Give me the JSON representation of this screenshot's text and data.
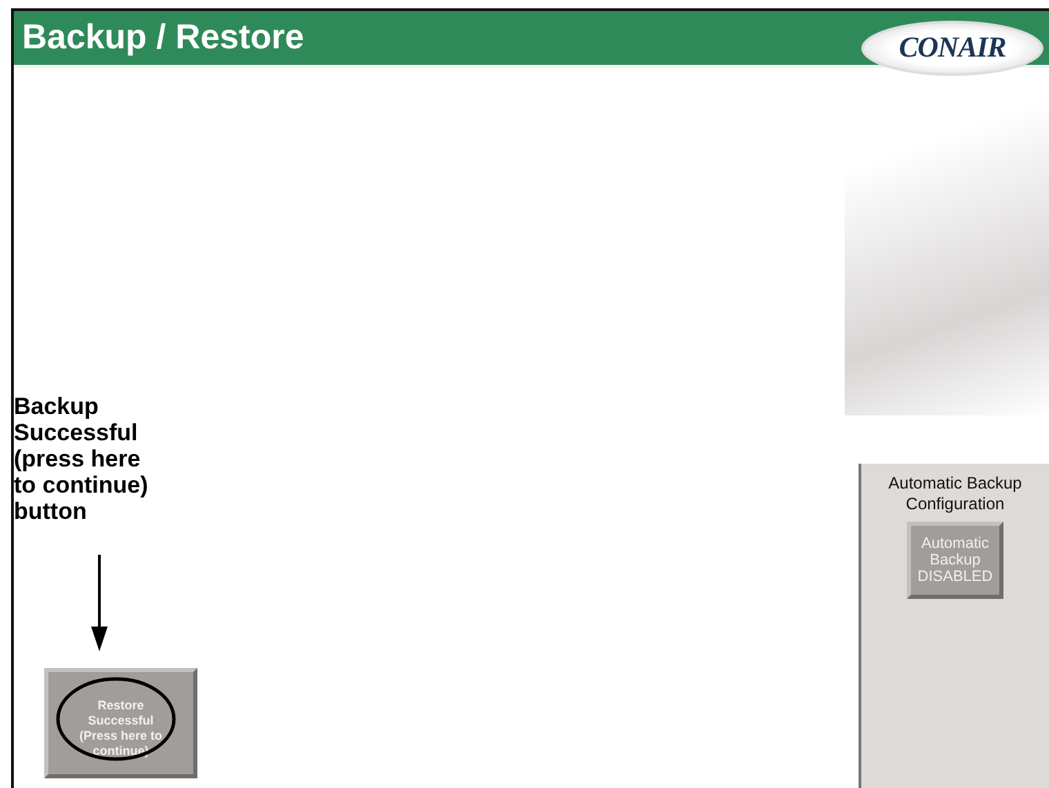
{
  "header": {
    "title": "Backup / Restore",
    "logo": "CONAIR"
  },
  "annotation": {
    "text": "Backup\nSuccessful\n(press here\nto continue)\nbutton"
  },
  "restore_button": {
    "label": "Restore\nSuccessful\n(Press here to\ncontinue)"
  },
  "auto_backup_panel": {
    "title": "Automatic Backup\nConfiguration",
    "button": {
      "label": "Automatic\nBackup\nDISABLED"
    }
  }
}
